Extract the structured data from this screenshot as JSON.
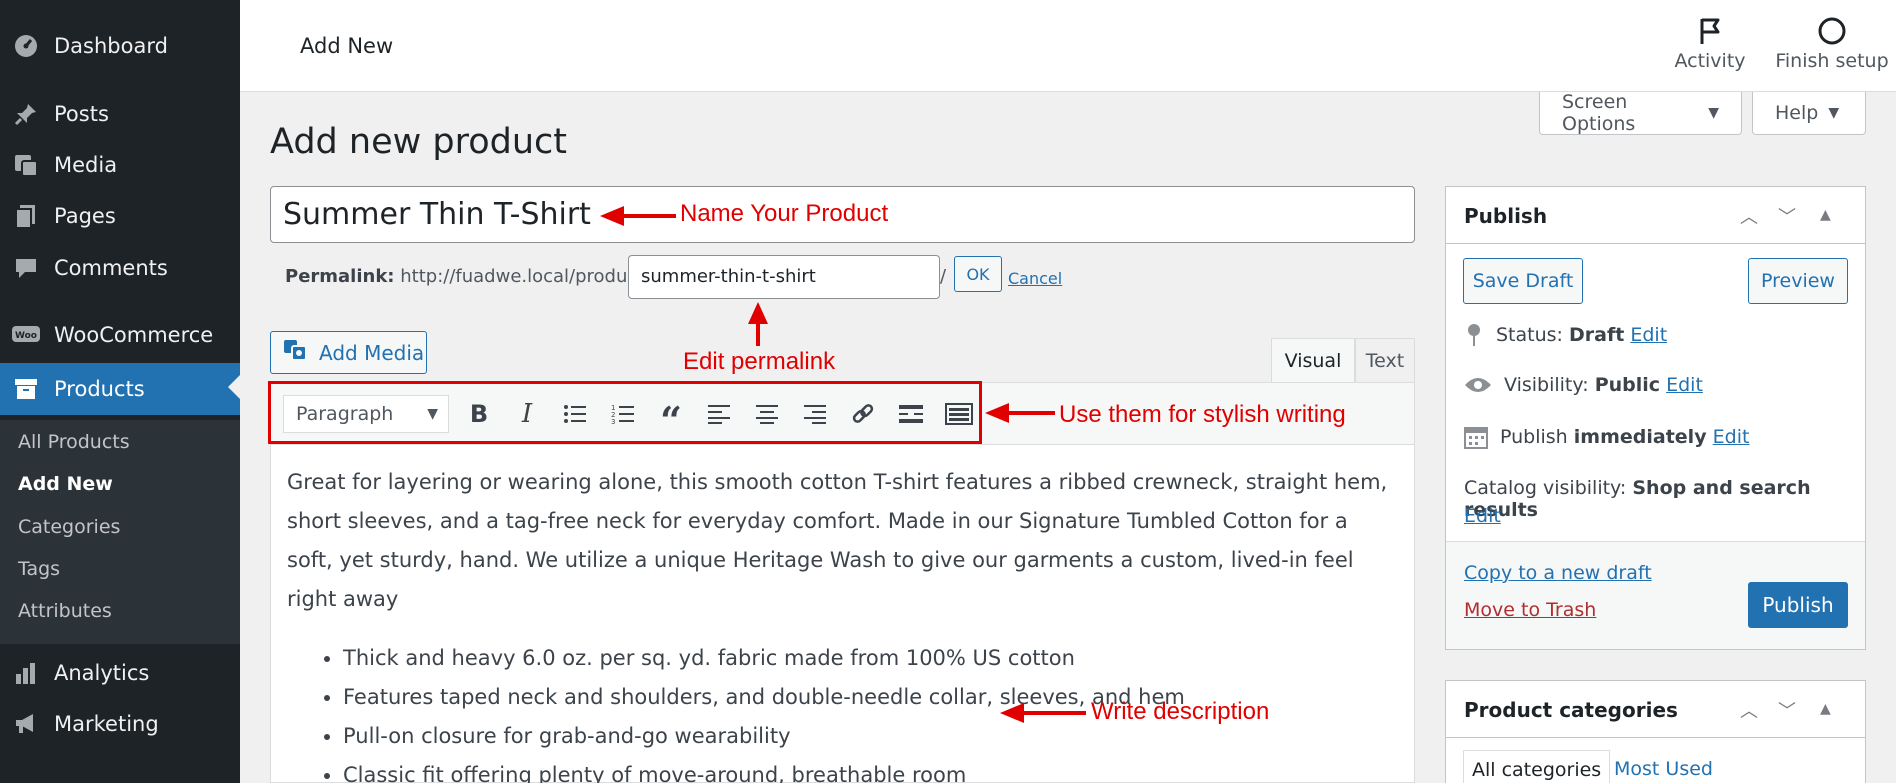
{
  "sidebar": {
    "items": [
      {
        "label": "Dashboard",
        "icon": "dashboard-icon"
      },
      {
        "label": "Posts",
        "icon": "pushpin-icon"
      },
      {
        "label": "Media",
        "icon": "media-icon"
      },
      {
        "label": "Pages",
        "icon": "pages-icon"
      },
      {
        "label": "Comments",
        "icon": "comment-icon"
      },
      {
        "label": "WooCommerce",
        "icon": "woo-icon"
      },
      {
        "label": "Products",
        "icon": "archive-icon"
      },
      {
        "label": "Analytics",
        "icon": "chart-icon"
      },
      {
        "label": "Marketing",
        "icon": "megaphone-icon"
      }
    ],
    "submenu": [
      "All Products",
      "Add New",
      "Categories",
      "Tags",
      "Attributes"
    ]
  },
  "topbar": {
    "title": "Add New",
    "activity_label": "Activity",
    "finish_label": "Finish setup"
  },
  "screen_options_label": "Screen Options",
  "help_label": "Help",
  "page_title": "Add new product",
  "product": {
    "title": "Summer Thin T-Shirt",
    "permalink_label": "Permalink:",
    "permalink_base": "http://fuadwe.local/product/",
    "slug": "summer-thin-t-shirt",
    "ok_label": "OK",
    "cancel_label": "Cancel"
  },
  "editor": {
    "add_media_label": "Add Media",
    "tab_visual": "Visual",
    "tab_text": "Text",
    "format_value": "Paragraph",
    "paragraph": "Great for layering or wearing alone, this smooth cotton T-shirt features a ribbed crewneck, straight hem, short sleeves, and a tag-free neck for everyday comfort. Made in our Signature Tumbled Cotton for a soft, yet sturdy, hand. We utilize a unique Heritage Wash to give our garments a custom, lived-in feel right away",
    "bullets": [
      "Thick and heavy 6.0 oz. per sq. yd. fabric made from 100% US cotton",
      "Features taped neck and shoulders, and double-needle collar, sleeves, and hem",
      "Pull-on closure for grab-and-go wearability",
      "Classic fit offering plenty of move-around, breathable room"
    ]
  },
  "publish": {
    "title": "Publish",
    "save_draft_label": "Save Draft",
    "preview_label": "Preview",
    "status_label": "Status:",
    "status_value": "Draft",
    "visibility_label": "Visibility:",
    "visibility_value": "Public",
    "publish_label_pre": "Publish",
    "publish_value": "immediately",
    "catalog_label": "Catalog visibility:",
    "catalog_value": "Shop and search results",
    "edit_label": "Edit",
    "copy_label": "Copy to a new draft",
    "trash_label": "Move to Trash",
    "publish_button": "Publish"
  },
  "categories_box": {
    "title": "Product categories",
    "tab_all": "All categories",
    "tab_most": "Most Used"
  },
  "annotations": {
    "name": "Name Your Product",
    "permalink": "Edit permalink",
    "toolbar": "Use them for stylish writing",
    "description": "Write description"
  },
  "colors": {
    "sidebar_bg": "#1d2327",
    "accent": "#2271b1",
    "annotation_red": "#e00000",
    "trash_red": "#b32d2e"
  }
}
